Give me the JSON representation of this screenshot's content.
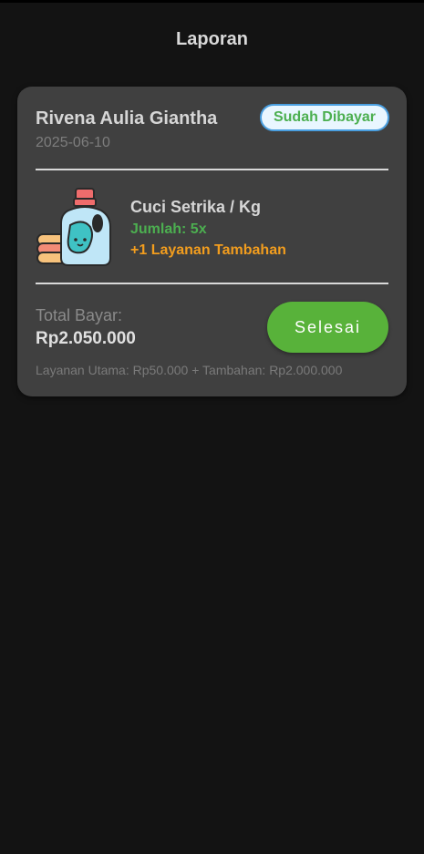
{
  "app_bar": {
    "title": "Laporan"
  },
  "order": {
    "customer_name": "Rivena Aulia Giantha",
    "date": "2025-06-10",
    "status": "Sudah Dibayar",
    "service_name": "Cuci Setrika / Kg",
    "quantity_text": "Jumlah: 5x",
    "extra_services_text": "+1 Layanan Tambahan",
    "total_label": "Total Bayar:",
    "total_value": "Rp2.050.000",
    "action_label": "Selesai",
    "breakdown": "Layanan Utama: Rp50.000 + Tambahan: Rp2.000.000",
    "product_icon": "detergent-bottle-icon"
  },
  "colors": {
    "background": "#131313",
    "card": "#404040",
    "status_text": "#4caf50",
    "status_border": "#4a9fe0",
    "extra_services": "#f29d1e",
    "action_button": "#58b23a"
  }
}
